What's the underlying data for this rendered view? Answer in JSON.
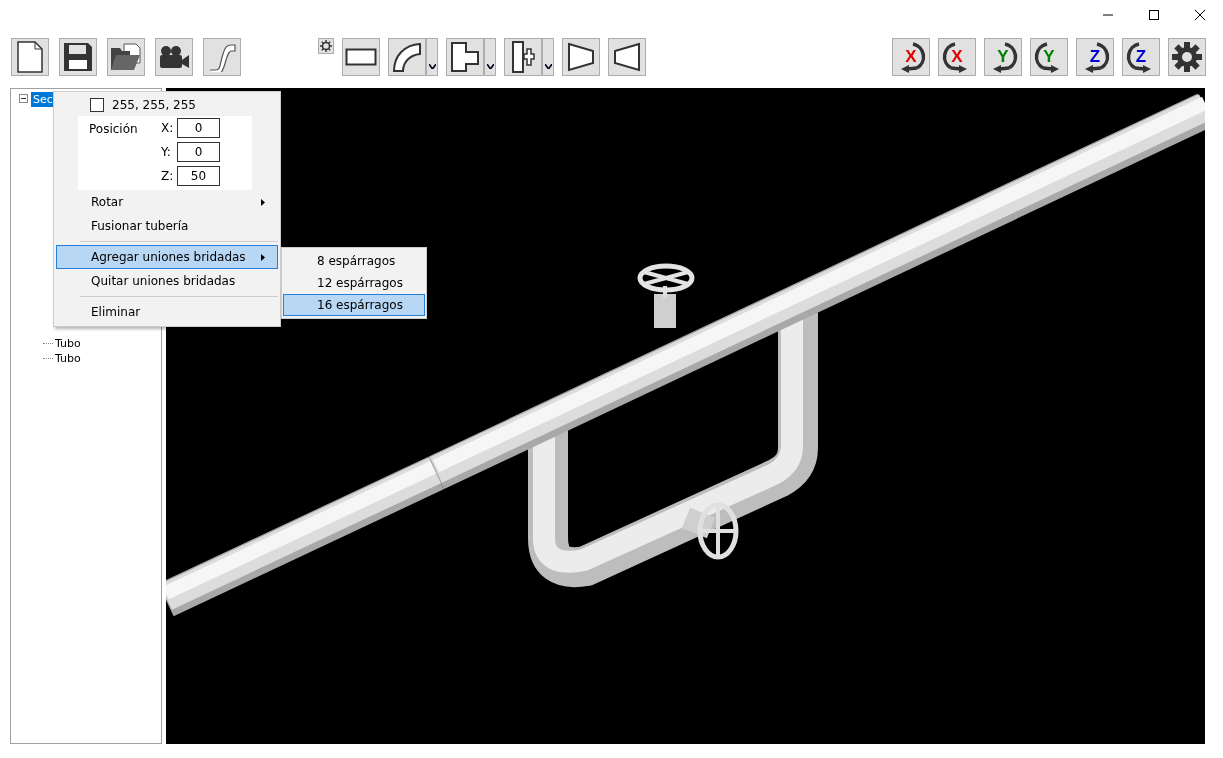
{
  "tree": [
    {
      "label": "Sec",
      "selected": true,
      "expanded": true,
      "children": [
        {
          "label": "Tubo",
          "selected": false
        },
        {
          "label": "Tubo",
          "selected": false
        }
      ]
    }
  ],
  "rotate_buttons": [
    {
      "label": "X",
      "color": "#e00000",
      "kind": "cw"
    },
    {
      "label": "X",
      "color": "#e00000",
      "kind": "ccw"
    },
    {
      "label": "Y",
      "color": "#008000",
      "kind": "cw"
    },
    {
      "label": "Y",
      "color": "#008000",
      "kind": "ccw"
    },
    {
      "label": "Z",
      "color": "#0000d0",
      "kind": "cw"
    },
    {
      "label": "Z",
      "color": "#0000d0",
      "kind": "ccw"
    }
  ],
  "context_menu": {
    "color": {
      "label": "255, 255, 255",
      "checked": false
    },
    "position": {
      "label": "Posición",
      "fields": [
        {
          "axis": "X:",
          "value": "0"
        },
        {
          "axis": "Y:",
          "value": "0"
        },
        {
          "axis": "Z:",
          "value": "50"
        }
      ]
    },
    "items": [
      {
        "kind": "item",
        "label": "Rotar",
        "submenu": true,
        "selected": false
      },
      {
        "kind": "item",
        "label": "Fusionar tubería",
        "submenu": false,
        "selected": false
      },
      {
        "kind": "separator"
      },
      {
        "kind": "item",
        "label": "Agregar uniones bridadas",
        "submenu": true,
        "selected": true
      },
      {
        "kind": "item",
        "label": "Quitar uniones bridadas",
        "submenu": false,
        "selected": false
      },
      {
        "kind": "separator"
      },
      {
        "kind": "item",
        "label": "Eliminar",
        "submenu": false,
        "selected": false
      }
    ]
  },
  "submenu": [
    {
      "label": "8 espárragos",
      "selected": false
    },
    {
      "label": "12 espárragos",
      "selected": false
    },
    {
      "label": "16 espárragos",
      "selected": true
    }
  ]
}
